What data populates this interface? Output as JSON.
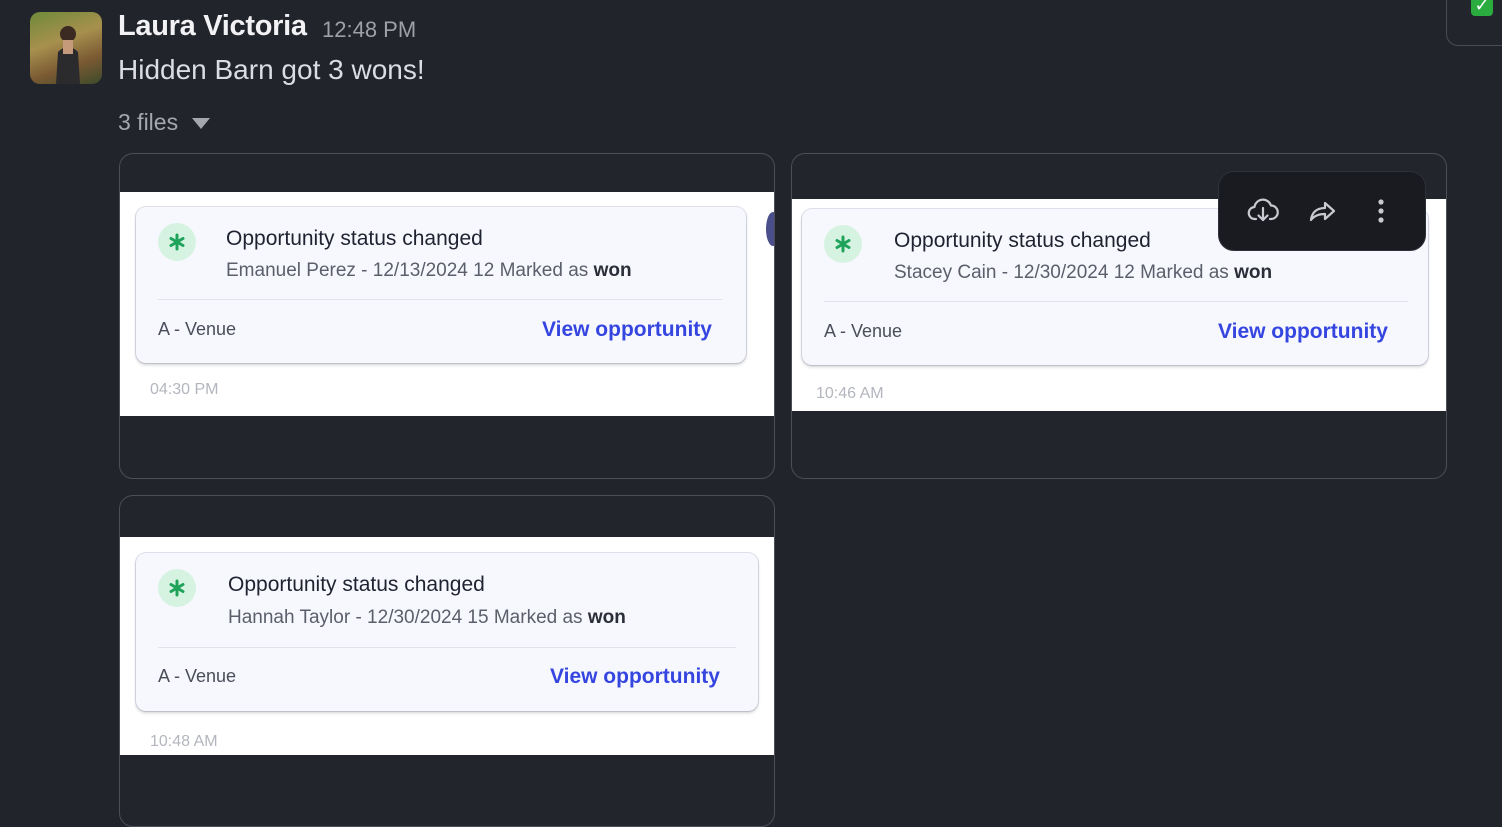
{
  "message": {
    "sender": "Laura Victoria",
    "time": "12:48 PM",
    "text": "Hidden Barn got 3 wons!",
    "files_label": "3 files"
  },
  "attachments": [
    {
      "card_title": "Opportunity status changed",
      "subtitle_prefix": "Emanuel Perez - 12/13/2024 12 Marked as",
      "subtitle_bold": "won",
      "venue": "A - Venue",
      "link": "View opportunity",
      "stamp": "04:30 PM"
    },
    {
      "card_title": "Opportunity status changed",
      "subtitle_prefix": "Stacey Cain - 12/30/2024 12 Marked as",
      "subtitle_bold": "won",
      "venue": "A - Venue",
      "link": "View opportunity",
      "stamp": "10:46 AM"
    },
    {
      "card_title": "Opportunity status changed",
      "subtitle_prefix": "Hannah Taylor - 12/30/2024 15 Marked as",
      "subtitle_bold": "won",
      "venue": "A - Venue",
      "link": "View opportunity",
      "stamp": "10:48 AM"
    }
  ],
  "hover_toolbar": {
    "icons": [
      "cloud-download-icon",
      "share-forward-icon",
      "more-vertical-icon"
    ]
  },
  "colors": {
    "background": "#22242c",
    "link": "#3545e0",
    "icon_bg": "#d6f3e2",
    "icon_fg": "#1fa35a",
    "badge": "#2bac3f"
  }
}
